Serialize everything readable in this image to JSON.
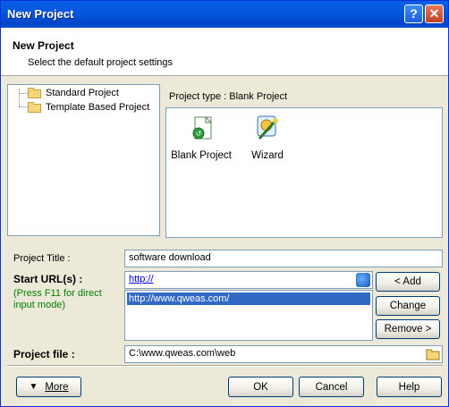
{
  "window": {
    "title": "New Project",
    "help_btn": "?",
    "close_btn": "✕"
  },
  "header": {
    "title": "New Project",
    "subtitle": "Select the default project settings"
  },
  "tree": {
    "items": [
      "Standard Project",
      "Template Based Project"
    ]
  },
  "project_type": {
    "label": "Project type : Blank Project",
    "items": [
      {
        "label": "Blank Project",
        "icon": "blank-project-icon"
      },
      {
        "label": "Wizard",
        "icon": "wizard-icon"
      }
    ]
  },
  "form": {
    "title_label": "Project Title :",
    "title_value": "software download",
    "url_label": "Start URL(s) :",
    "url_hint": "(Press F11 for direct input mode)",
    "url_value": "http://",
    "url_list": [
      "http://www.qweas.com/"
    ],
    "file_label": "Project file :",
    "file_value": "C:\\www.qweas.com\\web"
  },
  "buttons": {
    "add": "< Add",
    "change": "Change",
    "remove": "Remove >",
    "more": "More",
    "ok": "OK",
    "cancel": "Cancel",
    "help": "Help"
  }
}
